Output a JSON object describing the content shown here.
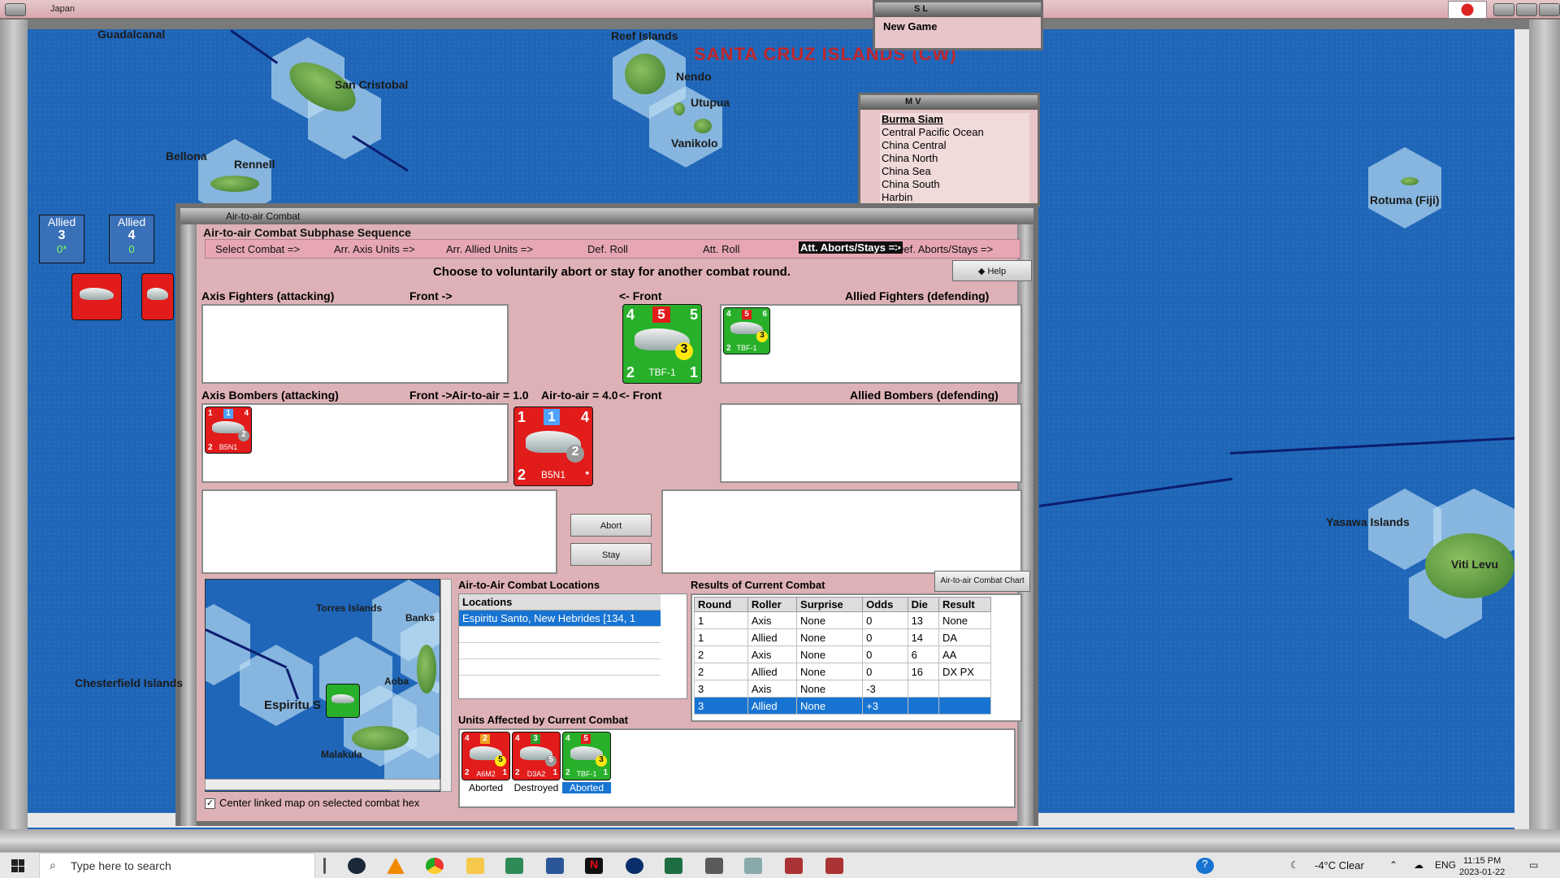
{
  "app": {
    "title": "Japan"
  },
  "map": {
    "title": "SANTA CRUZ ISLANDS (CW)",
    "labels": {
      "guadalcanal": "Guadalcanal",
      "san_cristobal": "San Cristobal",
      "reef_islands": "Reef Islands",
      "nendo": "Nendo",
      "utupua": "Utupua",
      "vanikolo": "Vanikolo",
      "bellona": "Bellona",
      "rennell": "Rennell",
      "rotuma": "Rotuma (Fiji)",
      "yasawa": "Yasawa Islands",
      "viti_levu": "Viti Levu"
    },
    "stacks": [
      {
        "label": "Allied",
        "value": "3",
        "sub": "0*"
      },
      {
        "label": "Allied",
        "value": "4",
        "sub": "0"
      }
    ]
  },
  "sl_panel": {
    "title": "S L",
    "item": "New Game"
  },
  "mv_panel": {
    "title": "M V",
    "items": [
      "Burma Siam",
      "Central Pacific Ocean",
      "China Central",
      "China North",
      "China Sea",
      "China South",
      "Harbin"
    ]
  },
  "dialog": {
    "title": "Air-to-air Combat",
    "sequence_title": "Air-to-air Combat Subphase Sequence",
    "phases": [
      "Select Combat =>",
      "Arr. Axis Units =>",
      "Arr. Allied Units =>",
      "Def. Roll",
      "Att. Roll",
      "Att. Aborts/Stays =>",
      "Def. Aborts/Stays =>"
    ],
    "instruction": "Choose to voluntarily abort or stay for another combat round.",
    "help": "Help",
    "axis_fighters": "Axis Fighters (attacking)",
    "front_right": "Front ->",
    "front_left": "<- Front",
    "allied_fighters": "Allied Fighters (defending)",
    "axis_bombers": "Axis Bombers (attacking)",
    "allied_bombers": "Allied Bombers (defending)",
    "axis_air_to_air": "Air-to-air = 1.0",
    "allied_air_to_air": "Air-to-air = 4.0",
    "abort_btn": "Abort",
    "stay_btn": "Stay",
    "locations_title": "Air-to-Air Combat Locations",
    "locations_header": "Locations",
    "locations": [
      "Espiritu Santo, New Hebrides [134, 1"
    ],
    "results_title": "Results of Current Combat",
    "chart_btn": "Air-to-air Combat Chart",
    "results_headers": [
      "Round",
      "Roller",
      "Surprise",
      "Odds",
      "Die",
      "Result"
    ],
    "results_rows": [
      [
        "1",
        "Axis",
        "None",
        "0",
        "13",
        "None"
      ],
      [
        "1",
        "Allied",
        "None",
        "0",
        "14",
        "DA"
      ],
      [
        "2",
        "Axis",
        "None",
        "0",
        "6",
        "AA"
      ],
      [
        "2",
        "Allied",
        "None",
        "0",
        "16",
        "DX PX"
      ],
      [
        "3",
        "Axis",
        "None",
        "-3",
        "",
        ""
      ],
      [
        "3",
        "Allied",
        "None",
        "+3",
        "",
        ""
      ]
    ],
    "units_title": "Units Affected by Current Combat",
    "units": [
      {
        "name": "A6M2",
        "status": "Aborted",
        "top_left": "4",
        "top_mid": "2",
        "circle": "5",
        "bl": "2",
        "br": "1"
      },
      {
        "name": "D3A2",
        "status": "Destroyed",
        "top_left": "4",
        "top_mid": "3",
        "circle": "5",
        "bl": "2",
        "br": "1"
      },
      {
        "name": "TBF-1",
        "status": "Aborted",
        "top_left": "4",
        "top_mid": "5",
        "circle": "3",
        "bl": "2",
        "br": "1"
      }
    ],
    "center_map_label": "Center linked map on selected combat hex",
    "minimap_labels": {
      "torres": "Torres Islands",
      "banks": "Banks",
      "espiritu": "Espiritu S",
      "aoba": "Aoba",
      "malakula": "Malakula",
      "chesterfield": "Chesterfield Islands"
    },
    "big_allied_counter": {
      "name": "TBF-1",
      "tl": "4",
      "tm": "5",
      "tr": "5",
      "circle": "3",
      "bl": "2",
      "br": "1"
    },
    "big_axis_counter": {
      "name": "B5N1",
      "tl": "1",
      "tm": "1",
      "tr": "4",
      "circle": "2",
      "bl": "2",
      "br": "*"
    },
    "small_allied_counter": {
      "name": "TBF-1",
      "tl": "4",
      "tm": "5",
      "tr": "6",
      "circle": "3",
      "bl": "2"
    },
    "small_axis_counter": {
      "name": "B5N1",
      "tl": "1",
      "tm": "1",
      "tr": "4",
      "circle": "2",
      "bl": "2"
    }
  },
  "taskbar": {
    "search_placeholder": "Type here to search",
    "weather": "-4°C  Clear",
    "lang": "ENG",
    "time": "11:15 PM",
    "date": "2023-01-22"
  }
}
